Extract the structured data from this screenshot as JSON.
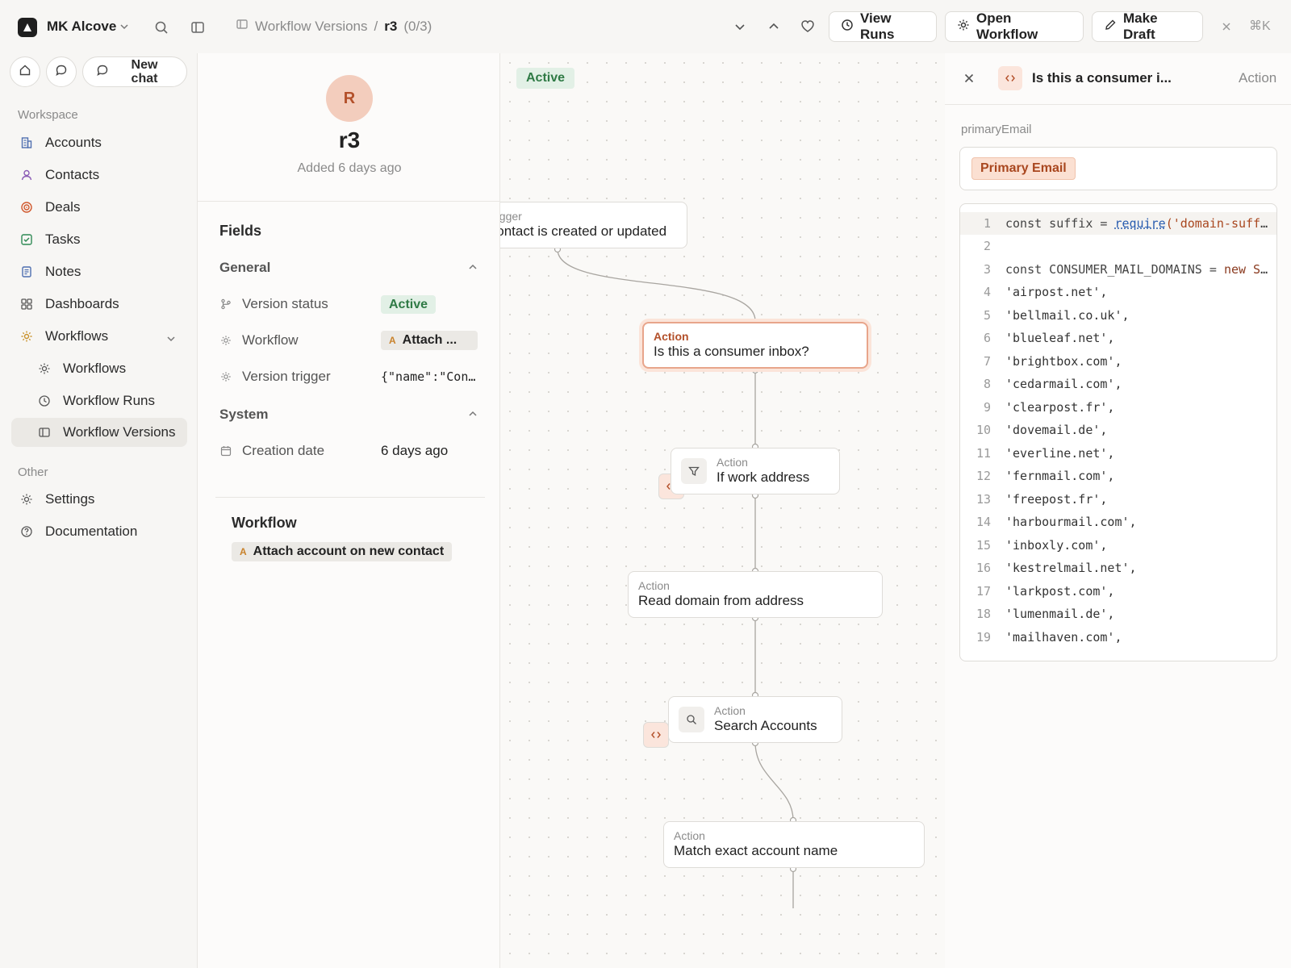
{
  "topbar": {
    "workspace_name": "MK Alcove",
    "breadcrumb": {
      "parent": "Workflow Versions",
      "separator": "/",
      "current": "r3",
      "counter": "(0/3)"
    },
    "buttons": {
      "view_runs": "View Runs",
      "open_workflow": "Open Workflow",
      "make_draft": "Make Draft"
    },
    "shortcut": "⌘K"
  },
  "sidebar": {
    "new_chat": "New chat",
    "workspace_label": "Workspace",
    "items": [
      {
        "label": "Accounts",
        "icon": "building-icon"
      },
      {
        "label": "Contacts",
        "icon": "user-icon"
      },
      {
        "label": "Deals",
        "icon": "target-icon"
      },
      {
        "label": "Tasks",
        "icon": "checkbox-icon"
      },
      {
        "label": "Notes",
        "icon": "note-icon"
      },
      {
        "label": "Dashboards",
        "icon": "grid-icon"
      },
      {
        "label": "Workflows",
        "icon": "gear-icon"
      }
    ],
    "sub_items": [
      {
        "label": "Workflows",
        "icon": "gear-icon"
      },
      {
        "label": "Workflow Runs",
        "icon": "clock-icon"
      },
      {
        "label": "Workflow Versions",
        "icon": "panel-icon",
        "active": true
      }
    ],
    "other_label": "Other",
    "other_items": [
      {
        "label": "Settings",
        "icon": "gear-icon"
      },
      {
        "label": "Documentation",
        "icon": "help-icon"
      }
    ]
  },
  "record": {
    "avatar_letter": "R",
    "title": "r3",
    "subtitle": "Added 6 days ago",
    "fields_title": "Fields",
    "general_title": "General",
    "fields": [
      {
        "label": "Version status",
        "value": "Active"
      },
      {
        "label": "Workflow",
        "value": "Attach ...",
        "chip_letter": "A"
      },
      {
        "label": "Version trigger",
        "value": "{\"name\":\"Con…"
      }
    ],
    "system_title": "System",
    "system_fields": [
      {
        "label": "Creation date",
        "value": "6 days ago"
      }
    ],
    "workflow_title": "Workflow",
    "workflow_chip": {
      "letter": "A",
      "label": "Attach account on new contact"
    }
  },
  "canvas": {
    "status_badge": "Active",
    "nodes": [
      {
        "kind": "Trigger",
        "label": "Contact is created or updated"
      },
      {
        "kind": "Action",
        "label": "Is this a consumer inbox?",
        "selected": true
      },
      {
        "kind": "Action",
        "label": "If work address"
      },
      {
        "kind": "Action",
        "label": "Read domain from address"
      },
      {
        "kind": "Action",
        "label": "Search Accounts"
      },
      {
        "kind": "Action",
        "label": "Match exact account name"
      }
    ]
  },
  "panel": {
    "title": "Is this a consumer i...",
    "kind": "Action",
    "field_label": "primaryEmail",
    "pill": "Primary Email",
    "code_lines": [
      {
        "n": "1",
        "text": "const suffix = require('domain-suffi…"
      },
      {
        "n": "2",
        "text": ""
      },
      {
        "n": "3",
        "text": "const CONSUMER_MAIL_DOMAINS = new Se…"
      },
      {
        "n": "4",
        "text": "  'airpost.net',"
      },
      {
        "n": "5",
        "text": "  'bellmail.co.uk',"
      },
      {
        "n": "6",
        "text": "  'blueleaf.net',"
      },
      {
        "n": "7",
        "text": "  'brightbox.com',"
      },
      {
        "n": "8",
        "text": "  'cedarmail.com',"
      },
      {
        "n": "9",
        "text": "  'clearpost.fr',"
      },
      {
        "n": "10",
        "text": "  'dovemail.de',"
      },
      {
        "n": "11",
        "text": "  'everline.net',"
      },
      {
        "n": "12",
        "text": "  'fernmail.com',"
      },
      {
        "n": "13",
        "text": "  'freepost.fr',"
      },
      {
        "n": "14",
        "text": "  'harbourmail.com',"
      },
      {
        "n": "15",
        "text": "  'inboxly.com',"
      },
      {
        "n": "16",
        "text": "  'kestrelmail.net',"
      },
      {
        "n": "17",
        "text": "  'larkpost.com',"
      },
      {
        "n": "18",
        "text": "  'lumenmail.de',"
      },
      {
        "n": "19",
        "text": "  'mailhaven.com',"
      }
    ]
  },
  "colors": {
    "accent": "#b3502a",
    "active_green": "#2f7a45",
    "selected_border": "#e8a58b"
  }
}
